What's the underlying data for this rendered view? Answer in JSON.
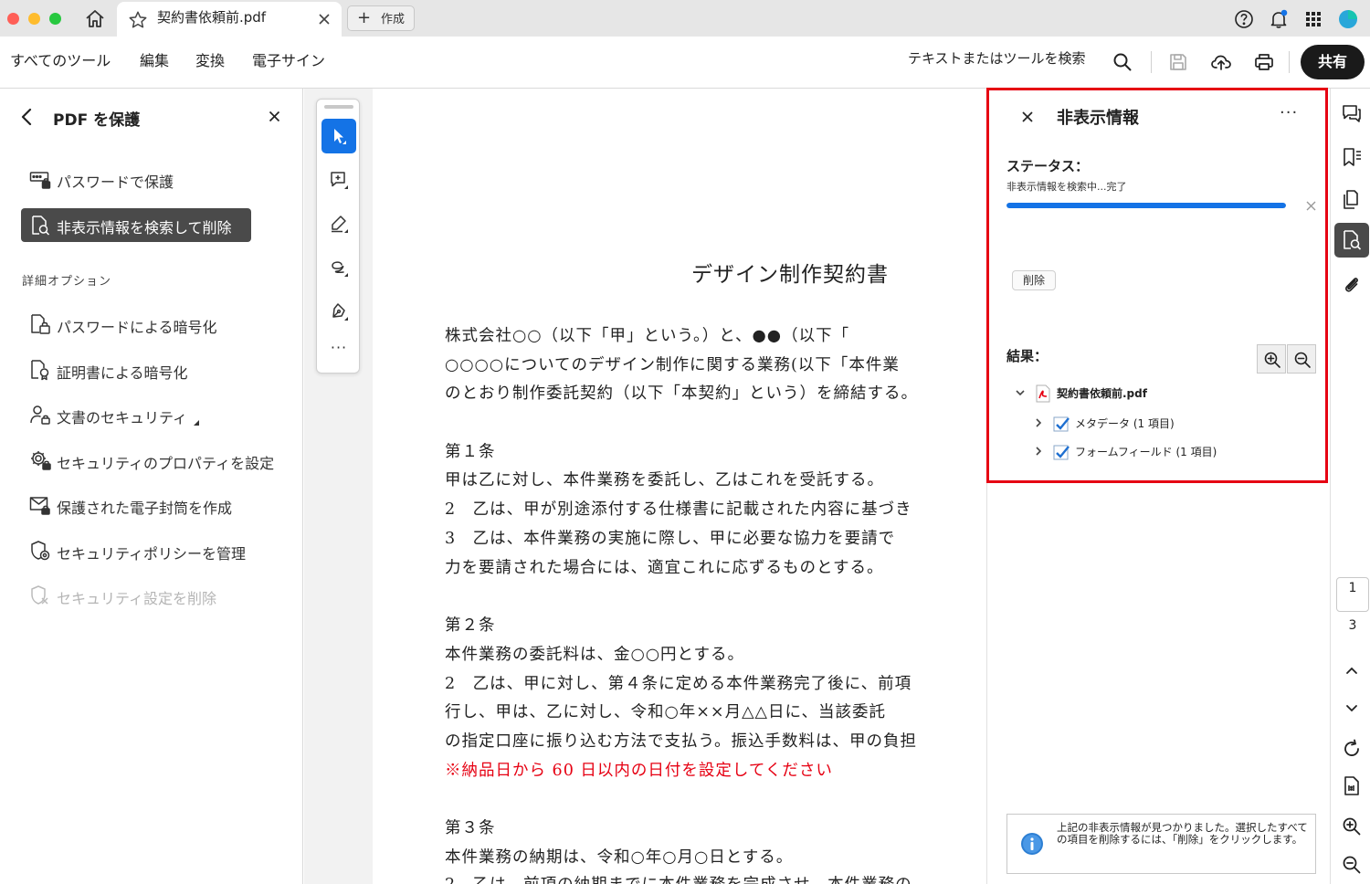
{
  "titlebar": {
    "tab_title": "契約書依頼前.pdf",
    "new_tab_label": "作成"
  },
  "menubar": {
    "items": [
      "すべてのツール",
      "編集",
      "変換",
      "電子サイン"
    ],
    "search_label": "テキストまたはツールを検索",
    "share_label": "共有"
  },
  "left_panel": {
    "title": "PDF を保護",
    "items": [
      {
        "label": "パスワードで保護"
      },
      {
        "label": "非表示情報を検索して削除"
      }
    ],
    "section_label": "詳細オプション",
    "advanced": [
      {
        "label": "パスワードによる暗号化"
      },
      {
        "label": "証明書による暗号化"
      },
      {
        "label": "文書のセキュリティ"
      },
      {
        "label": "セキュリティのプロパティを設定"
      },
      {
        "label": "保護された電子封筒を作成"
      },
      {
        "label": "セキュリティポリシーを管理"
      },
      {
        "label": "セキュリティ設定を削除"
      }
    ]
  },
  "document": {
    "title": "デザイン制作契約書",
    "lines": [
      "株式会社○○（以下「甲」という。）と、●●（以下「",
      "○○○○についてのデザイン制作に関する業務(以下「本件業",
      "のとおり制作委託契約（以下「本契約」という）を締結する。",
      "第１条",
      "甲は乙に対し、本件業務を委託し、乙はこれを受託する。",
      "2　乙は、甲が別途添付する仕様書に記載された内容に基づき",
      "3　乙は、本件業務の実施に際し、甲に必要な協力を要請で",
      "力を要請された場合には、適宜これに応ずるものとする。",
      "第２条",
      "本件業務の委託料は、金○○円とする。",
      "2　乙は、甲に対し、第４条に定める本件業務完了後に、前項",
      "行し、甲は、乙に対し、令和○年××月△△日に、当該委託",
      "の指定口座に振り込む方法で支払う。振込手数料は、甲の負担",
      "※納品日から 60 日以内の日付を設定してください",
      "第３条",
      "本件業務の納期は、令和○年○月○日とする。",
      "2　乙は、前項の納期までに本件業務を完成させ、本件業務の"
    ]
  },
  "redaction_panel": {
    "title": "非表示情報",
    "status_label": "ステータス：",
    "status_text": "非表示情報を検索中...完了",
    "progress_percent": 100,
    "delete_label": "削除",
    "results_label": "結果：",
    "tree": {
      "file": "契約書依頼前.pdf",
      "children": [
        {
          "label": "メタデータ (1 項目)"
        },
        {
          "label": "フォームフィールド (1 項目)"
        }
      ]
    },
    "info_text": "上記の非表示情報が見つかりました。選択したすべての項目を削除するには、「削除」をクリックします。"
  },
  "right_rail": {
    "current_page": "1",
    "total_pages": "3"
  },
  "colors": {
    "accent": "#1473e6",
    "highlight_border": "#e60012",
    "selected_bg": "#4a4a4a",
    "red_text": "#e60012"
  }
}
